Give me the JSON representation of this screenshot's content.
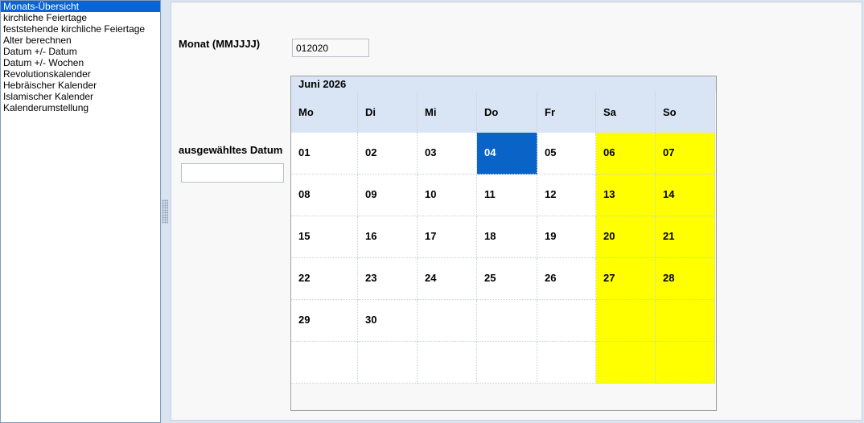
{
  "nav": {
    "items": [
      {
        "label": "Monats-Übersicht",
        "selected": true
      },
      {
        "label": "kirchliche Feiertage"
      },
      {
        "label": "feststehende kirchliche Feiertage"
      },
      {
        "label": "Alter berechnen"
      },
      {
        "label": "Datum +/- Datum"
      },
      {
        "label": "Datum +/- Wochen"
      },
      {
        "label": "Revolutionskalender"
      },
      {
        "label": "Hebräischer Kalender"
      },
      {
        "label": "Islamischer Kalender"
      },
      {
        "label": "Kalenderumstellung"
      }
    ]
  },
  "form": {
    "month_label": "Monat (MMJJJJ)",
    "month_value": "012020",
    "selected_date_label": "ausgewähltes Datum",
    "selected_date_value": ""
  },
  "calendar": {
    "title": "Juni 2026",
    "weekdays": [
      "Mo",
      "Di",
      "Mi",
      "Do",
      "Fr",
      "Sa",
      "So"
    ],
    "weeks": [
      [
        "01",
        "02",
        "03",
        "04",
        "05",
        "06",
        "07"
      ],
      [
        "08",
        "09",
        "10",
        "11",
        "12",
        "13",
        "14"
      ],
      [
        "15",
        "16",
        "17",
        "18",
        "19",
        "20",
        "21"
      ],
      [
        "22",
        "23",
        "24",
        "25",
        "26",
        "27",
        "28"
      ],
      [
        "29",
        "30",
        "",
        "",
        "",
        "",
        ""
      ],
      [
        "",
        "",
        "",
        "",
        "",
        "",
        ""
      ]
    ],
    "selected_day": "04",
    "colors": {
      "weekend": "#ffff00",
      "selected": "#0a64c8",
      "header": "#d9e5f4"
    }
  }
}
